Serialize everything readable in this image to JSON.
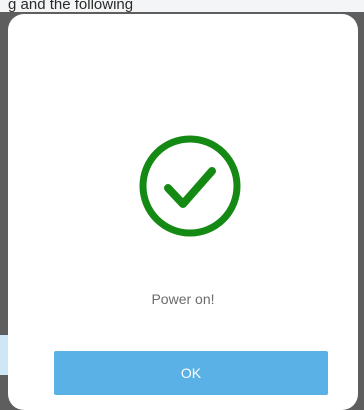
{
  "page": {
    "header_text": "g  and the following"
  },
  "dialog": {
    "icon": "checkmark-circle-icon",
    "message": "Power on!",
    "ok_label": "OK"
  },
  "colors": {
    "success": "#148a14",
    "button": "#5ab1e6",
    "button_text": "#ffffff",
    "message_text": "#6b6b6b",
    "overlay": "#5e5e5e"
  }
}
